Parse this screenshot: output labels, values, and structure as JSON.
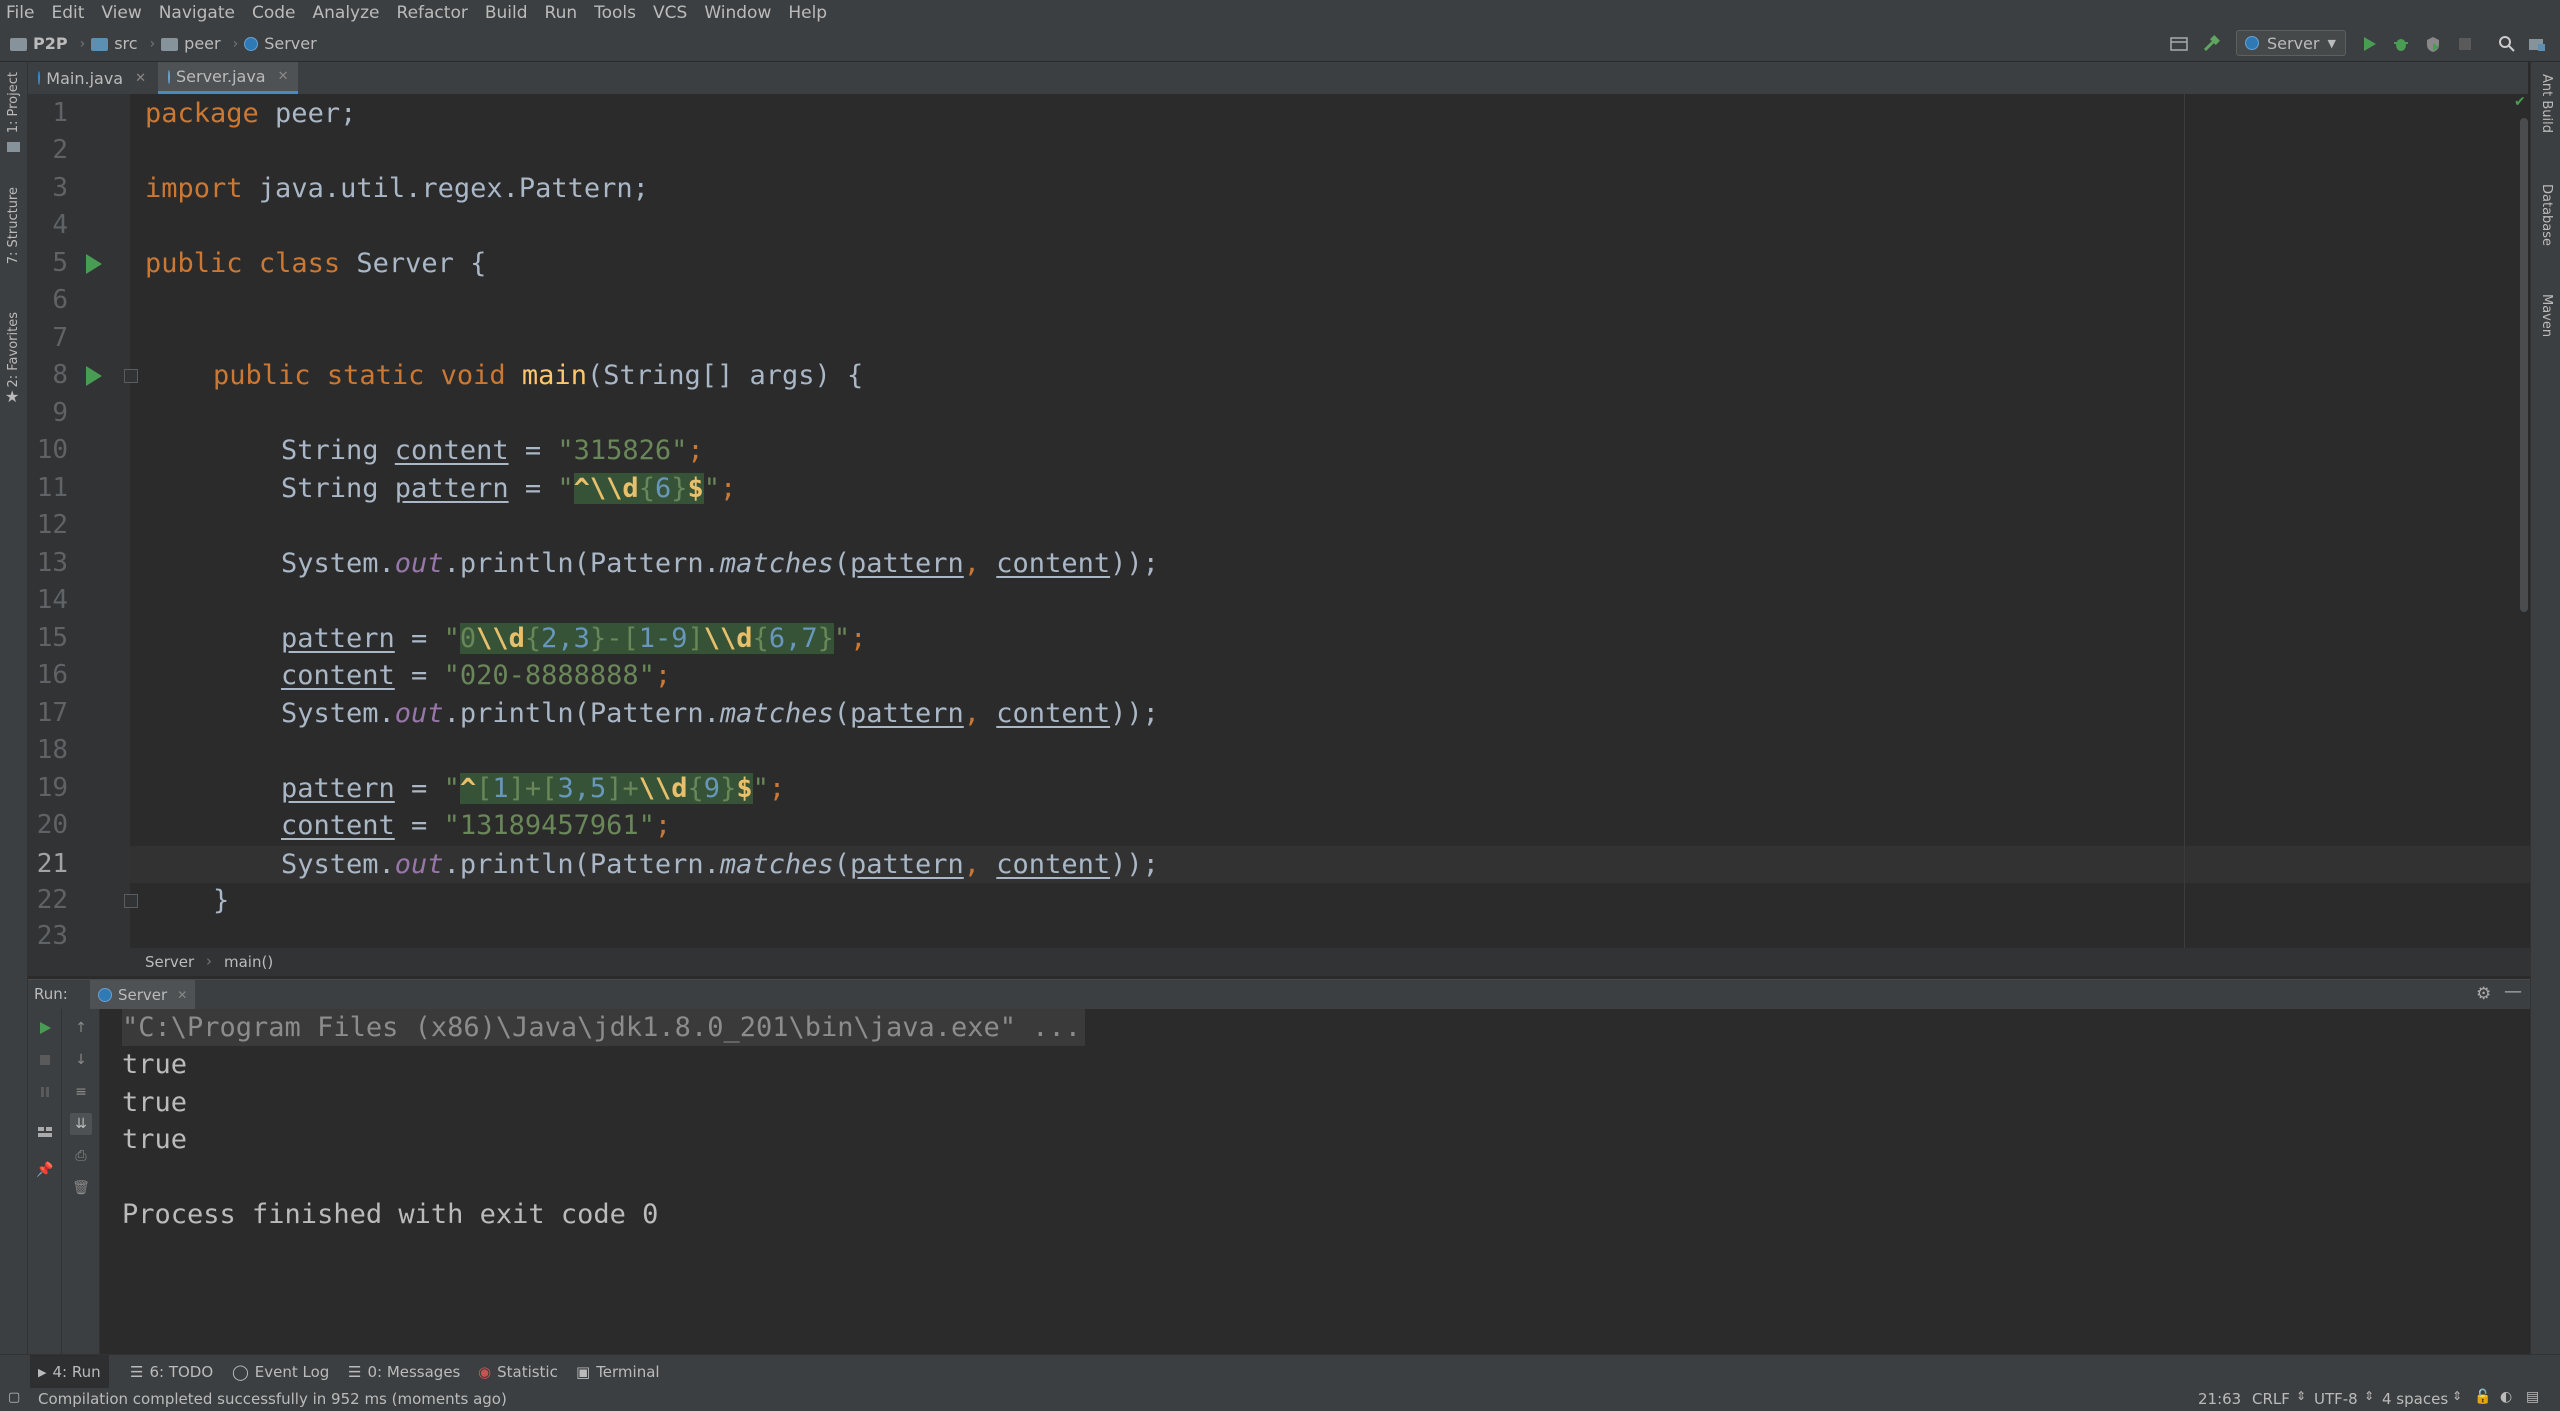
{
  "menu": [
    "File",
    "Edit",
    "View",
    "Navigate",
    "Code",
    "Analyze",
    "Refactor",
    "Build",
    "Run",
    "Tools",
    "VCS",
    "Window",
    "Help"
  ],
  "breadcrumb": {
    "project": "P2P",
    "folders": [
      "src",
      "peer"
    ],
    "file": "Server"
  },
  "run_config": "Server",
  "tabs": [
    {
      "label": "Main.java"
    },
    {
      "label": "Server.java",
      "active": true
    }
  ],
  "left_panels": [
    "1: Project",
    "7: Structure",
    "2: Favorites"
  ],
  "right_panels": [
    "Ant Build",
    "Database",
    "Maven"
  ],
  "line_numbers": [
    "1",
    "2",
    "3",
    "4",
    "5",
    "6",
    "7",
    "8",
    "9",
    "10",
    "11",
    "12",
    "13",
    "14",
    "15",
    "16",
    "17",
    "18",
    "19",
    "20",
    "21",
    "22",
    "23"
  ],
  "code": {
    "l1": {
      "kw": "package",
      "rest": " peer;"
    },
    "l3": {
      "kw": "import",
      "rest": " java.util.regex.Pattern;"
    },
    "l5": {
      "kw1": "public",
      "kw2": "class",
      "rest": " Server {"
    },
    "l8": {
      "kw1": "public",
      "kw2": "static",
      "kw3": "void",
      "fn": "main",
      "rest": "(String[] args) {"
    },
    "l10": {
      "type": "String ",
      "var": "content",
      "eq": " = ",
      "str": "\"315826\"",
      "end": ";"
    },
    "l11": {
      "type": "String ",
      "var": "pattern",
      "eq": " = ",
      "q": "\"",
      "r1": "^",
      "r2": "\\\\d",
      "r3": "{",
      "r4": "6",
      "r5": "}",
      "r6": "$",
      "q2": "\"",
      "end": ";"
    },
    "l13": {
      "a": "System.",
      "out": "out",
      "b": ".println(Pattern.",
      "m": "matches",
      "c": "(",
      "p": "pattern",
      ",": ", ",
      "cn": "content",
      "d": "));"
    },
    "l15": {
      "var": "pattern",
      "eq": " = ",
      "q": "\"",
      "r1": "0",
      "r2": "\\\\d",
      "r3": "{",
      "r4": "2,3",
      "r5": "}",
      "r6": "-",
      "r7": "[",
      "r8": "1-9",
      "r9": "]",
      "r10": "\\\\d",
      "r11": "{",
      "r12": "6,7",
      "r13": "}",
      "q2": "\"",
      "end": ";"
    },
    "l16": {
      "var": "content",
      "eq": " = ",
      "str": "\"020-8888888\"",
      "end": ";"
    },
    "l19": {
      "var": "pattern",
      "eq": " = ",
      "q": "\"",
      "r1": "^",
      "r2": "[",
      "r3": "1",
      "r4": "]",
      "r5": "+",
      "r6": "[",
      "r7": "3,5",
      "r8": "]",
      "r9": "+",
      "r10": "\\\\d",
      "r11": "{",
      "r12": "9",
      "r13": "}",
      "r14": "$",
      "q2": "\"",
      "end": ";"
    },
    "l20": {
      "var": "content",
      "eq": " = ",
      "str": "\"13189457961\"",
      "end": ";"
    },
    "l22": {
      "rest": "}"
    }
  },
  "editor_breadcrumb": [
    "Server",
    "main()"
  ],
  "run_panel": {
    "label": "Run:",
    "tab": "Server"
  },
  "console": {
    "cmd": "\"C:\\Program Files (x86)\\Java\\jdk1.8.0_201\\bin\\java.exe\" ...",
    "lines": [
      "true",
      "true",
      "true"
    ],
    "exit": "Process finished with exit code 0"
  },
  "bottom_tools": [
    "4: Run",
    "6: TODO",
    "Event Log",
    "0: Messages",
    "Statistic",
    "Terminal"
  ],
  "status": {
    "message": "Compilation completed successfully in 952 ms (moments ago)",
    "position": "21:63",
    "line_sep": "CRLF",
    "encoding": "UTF-8",
    "indent": "4 spaces"
  },
  "colors": {
    "keyword": "#cc7832",
    "string": "#6a8759",
    "method": "#ffc66d",
    "field": "#9876aa",
    "run": "#499c54",
    "accent": "#4a88c7"
  }
}
